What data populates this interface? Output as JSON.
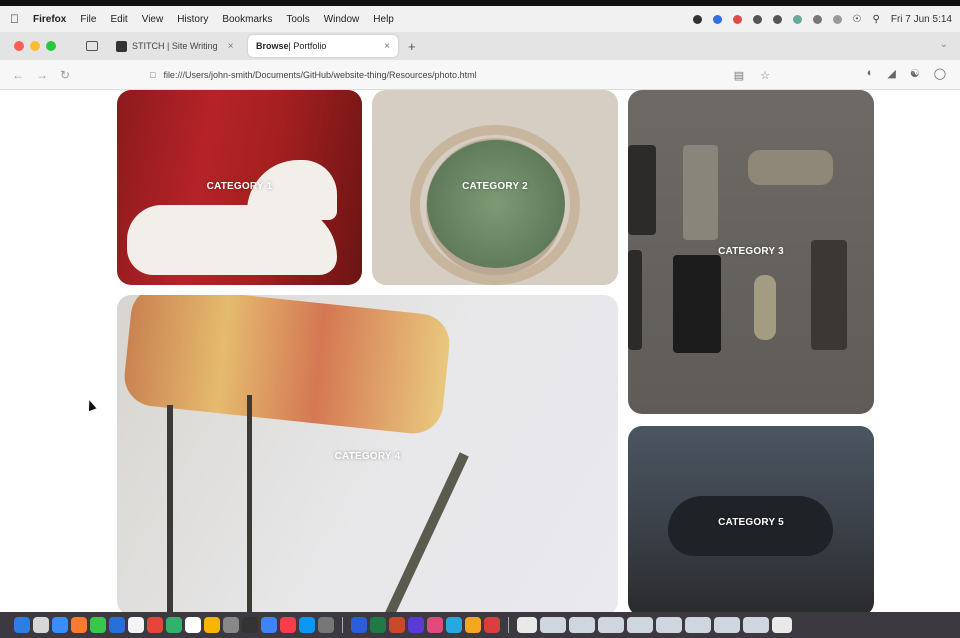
{
  "menubar": {
    "app_name": "Firefox",
    "items": [
      "File",
      "Edit",
      "View",
      "History",
      "Bookmarks",
      "Tools",
      "Window",
      "Help"
    ],
    "clock": "Fri 7 Jun 5:14"
  },
  "tabs": {
    "inactive_title": "STITCH | Site Writing",
    "active_title_bold": "Browse",
    "active_title_rest": " | Portfolio"
  },
  "nav": {
    "url": "file:///Users/john-smith/Documents/GitHub/website-thing/Resources/photo.html"
  },
  "gallery": {
    "tiles": [
      {
        "label": "CATEGORY 1"
      },
      {
        "label": "CATEGORY 2"
      },
      {
        "label": "CATEGORY 3"
      },
      {
        "label": "CATEGORY 4"
      },
      {
        "label": "CATEGORY 5"
      }
    ]
  },
  "colors": {
    "traffic_close": "#ff5f57",
    "traffic_min": "#febc2e",
    "traffic_max": "#28c840"
  },
  "icons": {
    "apple": "apple-icon",
    "back": "back-arrow-icon",
    "forward": "forward-arrow-icon",
    "reload": "reload-icon",
    "bookmark": "star-icon"
  }
}
